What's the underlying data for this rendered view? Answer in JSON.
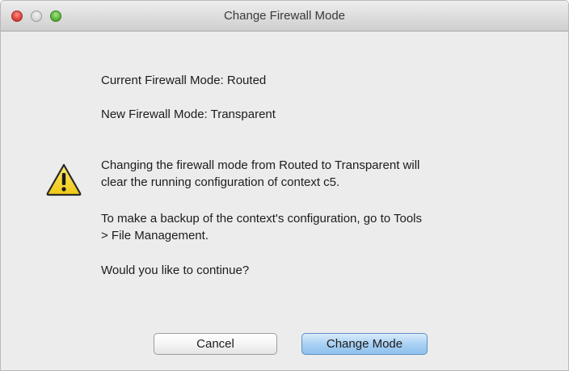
{
  "window": {
    "title": "Change Firewall Mode"
  },
  "dialog": {
    "current_mode": "Current Firewall Mode: Routed",
    "new_mode": "New Firewall Mode: Transparent",
    "warning_line1": "Changing the firewall mode from Routed to Transparent will",
    "warning_line2": "clear the running configuration of context c5.",
    "backup_line1": "To make a backup of the context's configuration, go to Tools",
    "backup_line2": "> File Management.",
    "question": "Would you like to continue?"
  },
  "buttons": {
    "cancel_label": "Cancel",
    "confirm_label": "Change Mode"
  },
  "icons": {
    "warning": "warning-triangle-icon"
  },
  "colors": {
    "primary_button": "#aad1f3",
    "warning_fill": "#f6d628",
    "close_light": "#e2463f",
    "maximize_light": "#5fb93d"
  }
}
